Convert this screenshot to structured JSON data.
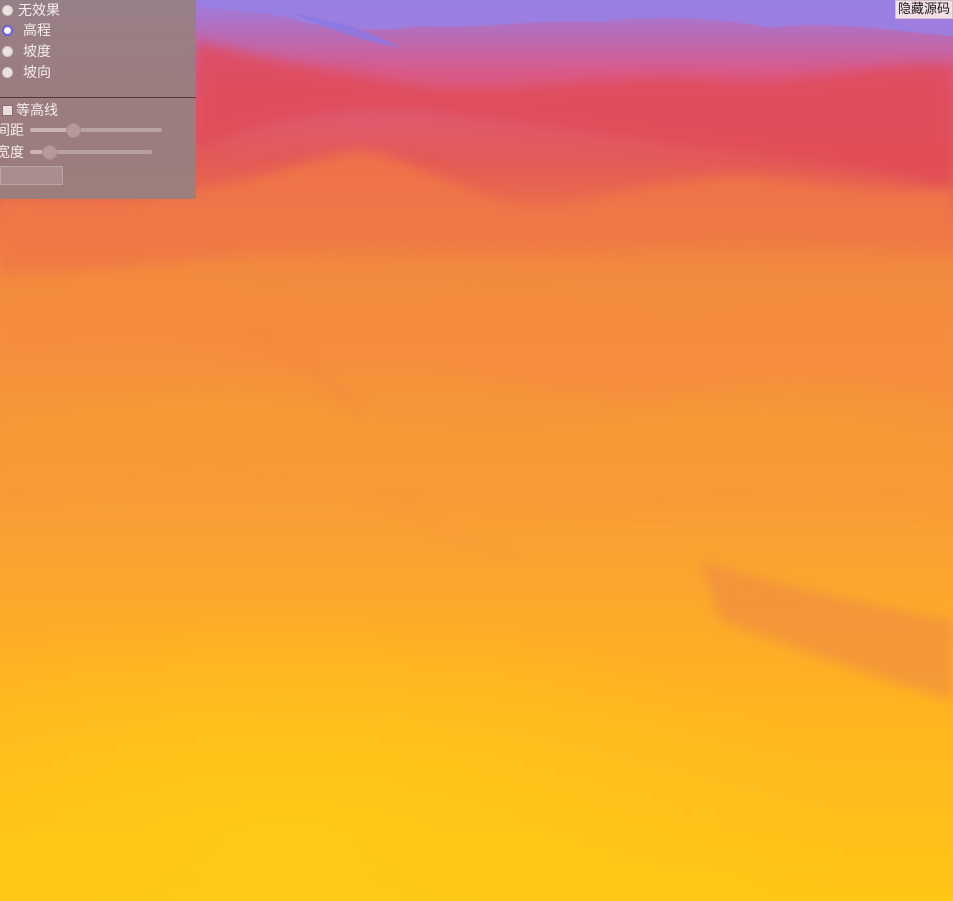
{
  "render_modes": [
    {
      "label": "无效果",
      "checked": false
    },
    {
      "label": "高程",
      "checked": true
    },
    {
      "label": "坡度",
      "checked": false
    },
    {
      "label": "坡向",
      "checked": false
    }
  ],
  "contour": {
    "checkbox_label": "等高线",
    "checked": false,
    "spacing_label": "间距",
    "spacing_value_fraction": 0.33,
    "width_label": "宽度",
    "width_value_fraction": 0.15
  },
  "toolbar": {
    "hide_source_label": "隐藏源码"
  },
  "colors": {
    "terrain_low": "#ffc21a",
    "terrain_mid": "#f79a3a",
    "terrain_high": "#e4504f",
    "terrain_peak": "#8f7fe0",
    "panel_bg": "#968080"
  }
}
